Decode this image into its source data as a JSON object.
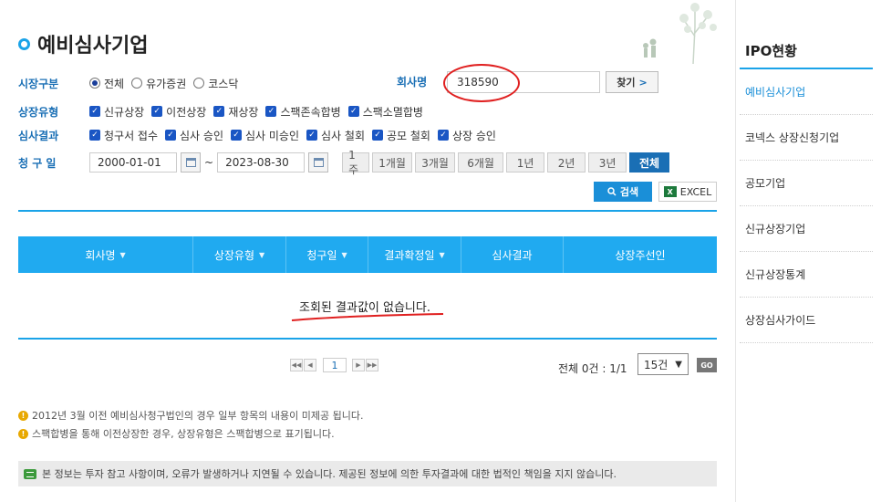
{
  "page_title": "예비심사기업",
  "filters": {
    "market": {
      "label": "시장구분",
      "options": [
        {
          "label": "전체",
          "selected": true
        },
        {
          "label": "유가증권",
          "selected": false
        },
        {
          "label": "코스닥",
          "selected": false
        }
      ]
    },
    "listing_type": {
      "label": "상장유형",
      "options": [
        "신규상장",
        "이전상장",
        "재상장",
        "스팩존속합병",
        "스팩소멸합병"
      ]
    },
    "review_result": {
      "label": "심사결과",
      "options": [
        "청구서 접수",
        "심사 승인",
        "심사 미승인",
        "심사 철회",
        "공모 철회",
        "상장 승인"
      ]
    },
    "claim_date": {
      "label": "청 구 일",
      "from": "2000-01-01",
      "separator": "~",
      "to": "2023-08-30",
      "periods": [
        "1주",
        "1개월",
        "3개월",
        "6개월",
        "1년",
        "2년",
        "3년",
        "전체"
      ],
      "active_period": "전체"
    },
    "company": {
      "label": "회사명",
      "value": "318590",
      "find_label": "찾기",
      "find_arrow": ">"
    }
  },
  "actions": {
    "search_label": "검색",
    "excel_label": "EXCEL"
  },
  "table": {
    "columns": [
      {
        "label": "회사명",
        "sortable": true
      },
      {
        "label": "상장유형",
        "sortable": true
      },
      {
        "label": "청구일",
        "sortable": true
      },
      {
        "label": "결과확정일",
        "sortable": true
      },
      {
        "label": "심사결과",
        "sortable": false
      },
      {
        "label": "상장주선인",
        "sortable": false
      }
    ],
    "empty_message": "조회된 결과값이 없습니다."
  },
  "pagination": {
    "current_page": "1",
    "total_text": "전체 0건 : 1/1",
    "page_size": "15건",
    "go_label": "GO"
  },
  "notes": [
    "2012년 3월 이전 예비심사청구법인의 경우 일부 항목의 내용이 미제공 됩니다.",
    "스팩합병을 통해 이전상장한 경우, 상장유형은 스팩합병으로 표기됩니다."
  ],
  "disclaimer": "본 정보는 투자 참고 사항이며, 오류가 발생하거나 지연될 수 있습니다. 제공된 정보에 의한 투자결과에 대한 법적인 책임을 지지 않습니다.",
  "sidebar": {
    "title": "IPO현황",
    "items": [
      "예비심사기업",
      "코넥스 상장신청기업",
      "공모기업",
      "신규상장기업",
      "신규상장통계",
      "상장심사가이드"
    ],
    "active": "예비심사기업"
  },
  "colors": {
    "accent": "#1aa3e8",
    "header_bg": "#20aaf0",
    "label_blue": "#1a6fb5",
    "annotation_red": "#e02020"
  },
  "icons": [
    "calendar-icon",
    "search-icon",
    "excel-icon",
    "bulb-icon",
    "info-icon",
    "first-page-icon",
    "prev-page-icon",
    "next-page-icon",
    "last-page-icon",
    "sort-caret-icon"
  ]
}
